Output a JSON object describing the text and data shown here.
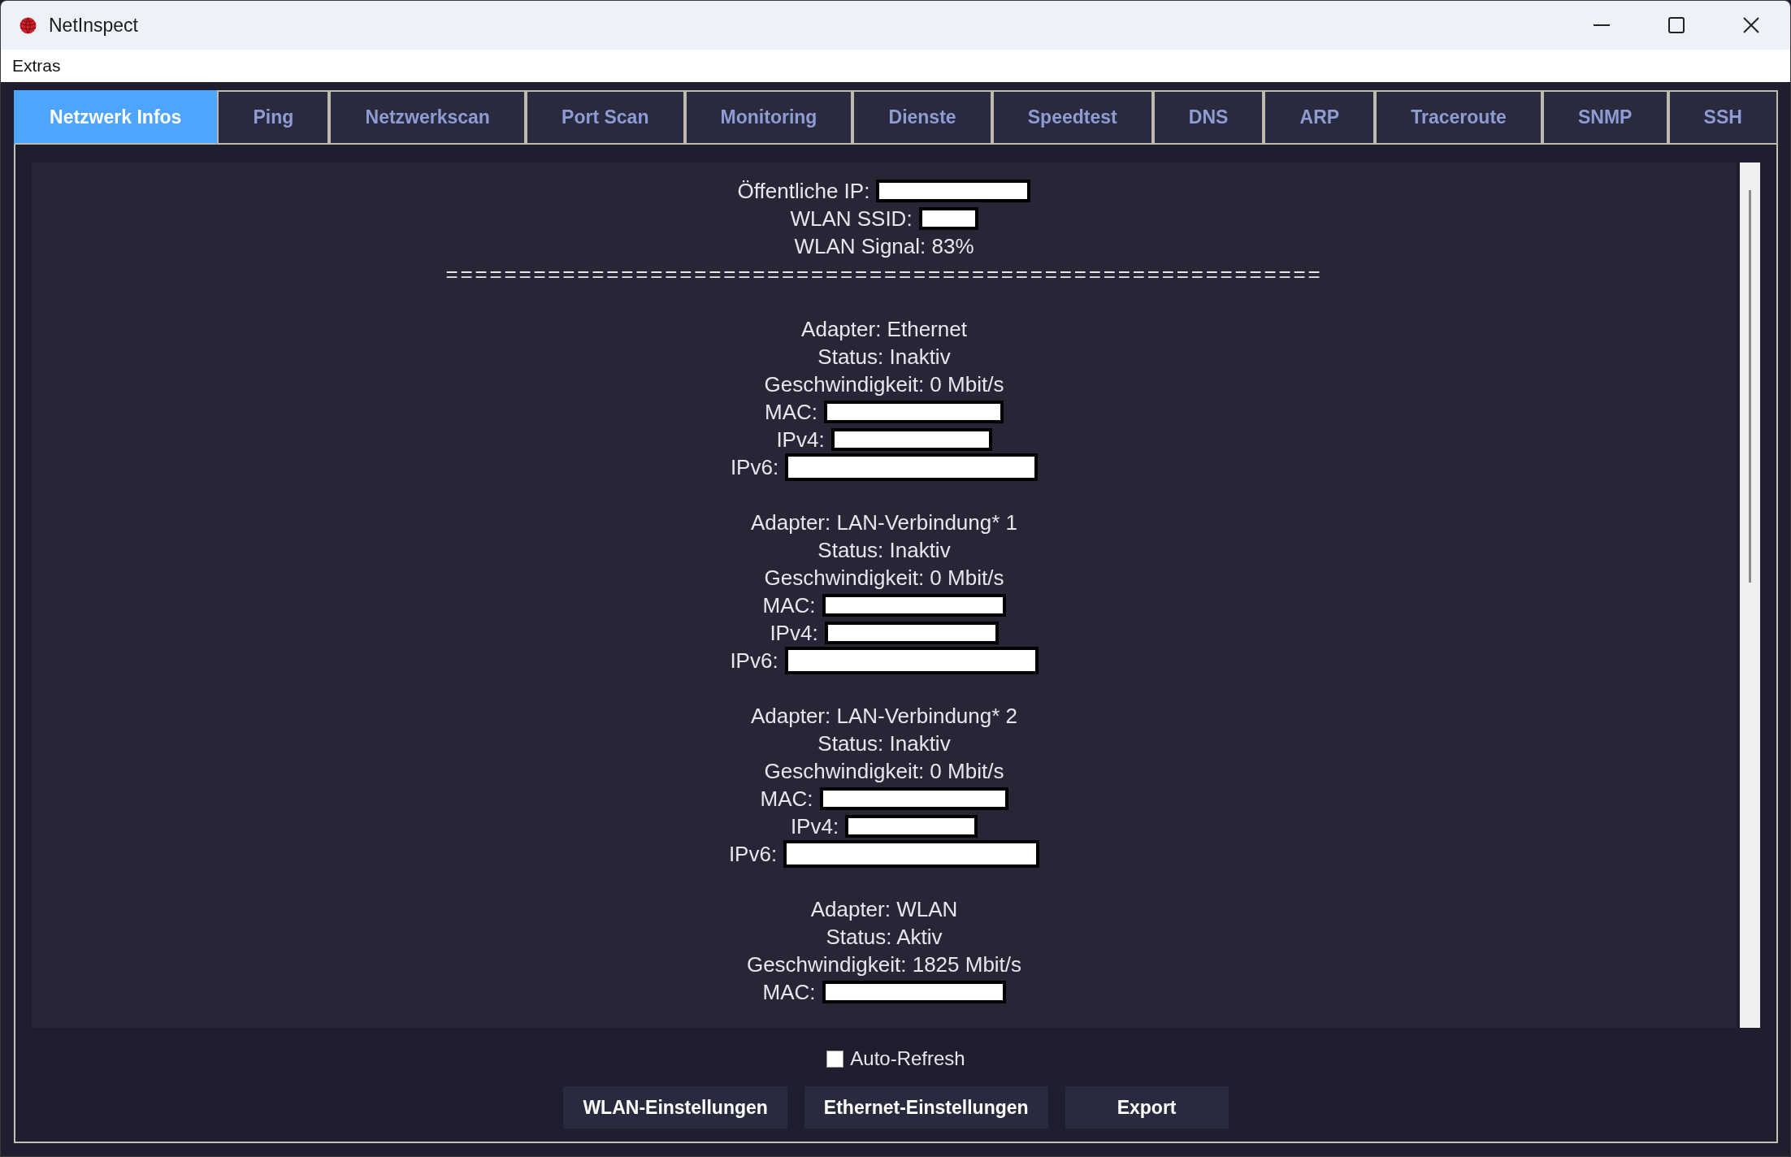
{
  "window": {
    "title": "NetInspect"
  },
  "menu_bar": {
    "items": [
      "Extras"
    ]
  },
  "tabs": [
    {
      "label": "Netzwerk Infos",
      "selected": true
    },
    {
      "label": "Ping",
      "selected": false
    },
    {
      "label": "Netzwerkscan",
      "selected": false
    },
    {
      "label": "Port Scan",
      "selected": false
    },
    {
      "label": "Monitoring",
      "selected": false
    },
    {
      "label": "Dienste",
      "selected": false
    },
    {
      "label": "Speedtest",
      "selected": false
    },
    {
      "label": "DNS",
      "selected": false
    },
    {
      "label": "ARP",
      "selected": false
    },
    {
      "label": "Traceroute",
      "selected": false
    },
    {
      "label": "SNMP",
      "selected": false
    },
    {
      "label": "SSH",
      "selected": false
    }
  ],
  "info_panel": {
    "header_lines": [
      {
        "kind": "redacted",
        "text": "Öffentliche IP:"
      },
      {
        "kind": "redacted",
        "text": "WLAN SSID:"
      },
      {
        "kind": "plain",
        "text": "WLAN Signal: 83%"
      }
    ],
    "separator": "============================================================",
    "adapters": [
      {
        "lines": [
          {
            "kind": "plain",
            "text": "Adapter: Ethernet"
          },
          {
            "kind": "plain",
            "text": "Status: Inaktiv"
          },
          {
            "kind": "plain",
            "text": "Geschwindigkeit: 0 Mbit/s"
          },
          {
            "kind": "redacted",
            "text": "MAC:"
          },
          {
            "kind": "redacted",
            "text": "IPv4:"
          },
          {
            "kind": "redacted",
            "text": "IPv6:"
          }
        ]
      },
      {
        "lines": [
          {
            "kind": "plain",
            "text": "Adapter: LAN-Verbindung* 1"
          },
          {
            "kind": "plain",
            "text": "Status: Inaktiv"
          },
          {
            "kind": "plain",
            "text": "Geschwindigkeit: 0 Mbit/s"
          },
          {
            "kind": "redacted",
            "text": "MAC:"
          },
          {
            "kind": "redacted",
            "text": "IPv4:"
          },
          {
            "kind": "redacted",
            "text": "IPv6:"
          }
        ]
      },
      {
        "lines": [
          {
            "kind": "plain",
            "text": "Adapter: LAN-Verbindung* 2"
          },
          {
            "kind": "plain",
            "text": "Status: Inaktiv"
          },
          {
            "kind": "plain",
            "text": "Geschwindigkeit: 0 Mbit/s"
          },
          {
            "kind": "redacted",
            "text": "MAC:"
          },
          {
            "kind": "redacted",
            "text": "IPv4:"
          },
          {
            "kind": "redacted",
            "text": "IPv6:"
          }
        ]
      },
      {
        "lines": [
          {
            "kind": "plain",
            "text": "Adapter: WLAN"
          },
          {
            "kind": "plain",
            "text": "Status: Aktiv"
          },
          {
            "kind": "plain",
            "text": "Geschwindigkeit: 1825 Mbit/s"
          },
          {
            "kind": "redacted",
            "text": "MAC:"
          }
        ]
      }
    ]
  },
  "auto_refresh": {
    "label": "Auto-Refresh",
    "checked": false
  },
  "buttons": [
    "WLAN-Einstellungen",
    "Ethernet-Einstellungen",
    "Export"
  ]
}
